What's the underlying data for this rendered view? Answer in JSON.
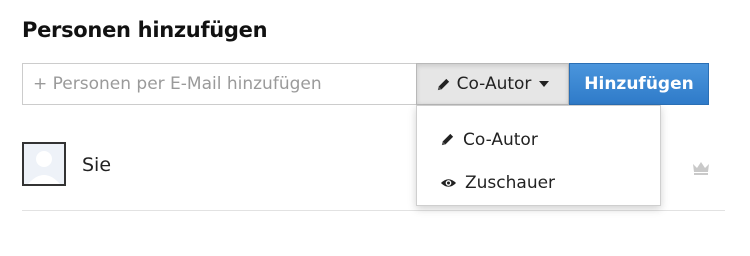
{
  "header": {
    "title": "Personen hinzufügen"
  },
  "add_form": {
    "placeholder": "+ Personen per E-Mail hinzufügen",
    "role_button_label": "Co-Autor",
    "role_button_icon": "pencil-icon",
    "submit_label": "Hinzufügen",
    "accent_color": "#3a87d3"
  },
  "role_menu": {
    "items": [
      {
        "label": "Co-Autor",
        "icon": "pencil-icon"
      },
      {
        "label": "Zuschauer",
        "icon": "eye-icon"
      }
    ]
  },
  "people": [
    {
      "name": "Sie",
      "avatar": "default-avatar",
      "role_icon": "crown-icon"
    }
  ]
}
